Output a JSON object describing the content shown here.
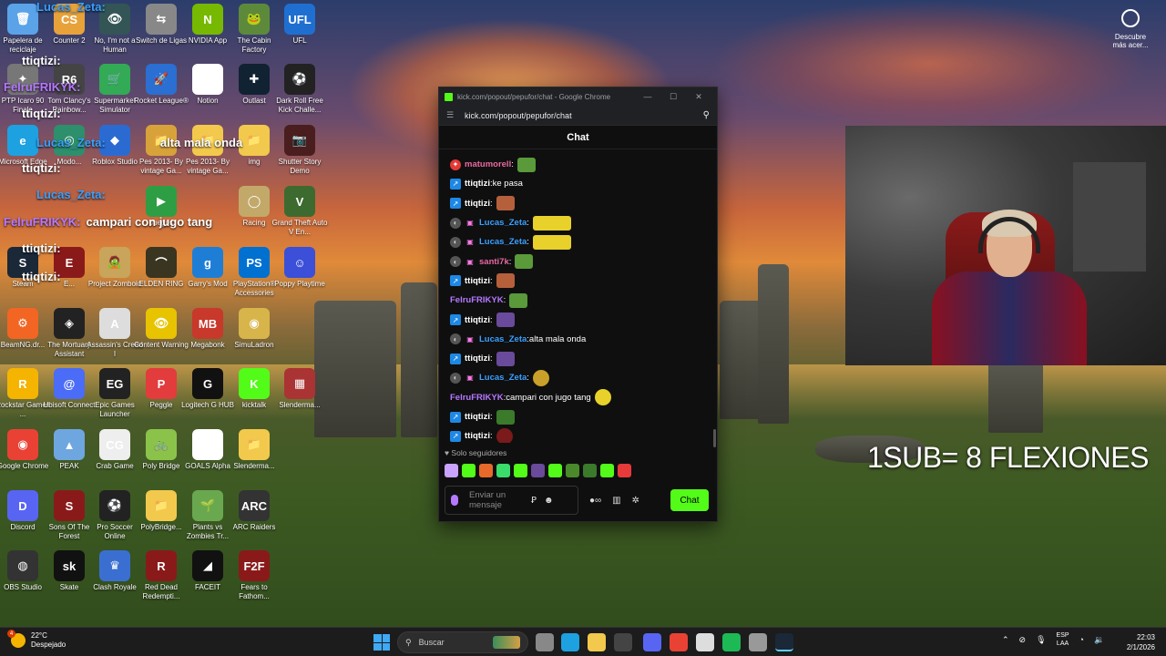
{
  "desktop_icons": [
    {
      "label": "Papelera de reciclaje",
      "color": "#5aa3e8",
      "glyph": "🗑"
    },
    {
      "label": "Counter 2",
      "color": "#e8a23a",
      "glyph": "CS"
    },
    {
      "label": "No, I'm not a Human",
      "color": "#355",
      "glyph": "👁"
    },
    {
      "label": "Switch de Ligas",
      "color": "#888",
      "glyph": "⇆"
    },
    {
      "label": "NVIDIA App",
      "color": "#76b900",
      "glyph": "N"
    },
    {
      "label": "The Cabin Factory",
      "color": "#5d8a3a",
      "glyph": "🐸"
    },
    {
      "label": "UFL",
      "color": "#1f6fd1",
      "glyph": "UFL"
    },
    {
      "label": "PTP Icaro 90 Finale",
      "color": "#777",
      "glyph": "✦"
    },
    {
      "label": "Tom Clancy's Rainbow...",
      "color": "#444",
      "glyph": "R6"
    },
    {
      "label": "Supermarket Simulator",
      "color": "#3a5",
      "glyph": "🛒"
    },
    {
      "label": "Rocket League®",
      "color": "#2a6fd1",
      "glyph": "🚀"
    },
    {
      "label": "Notion",
      "color": "#fff",
      "glyph": "N"
    },
    {
      "label": "Outlast",
      "color": "#123",
      "glyph": "✚"
    },
    {
      "label": "Dark Roll Free Kick Challe...",
      "color": "#222",
      "glyph": "⚽"
    },
    {
      "label": "Microsoft Edge",
      "color": "#1da1e0",
      "glyph": "e"
    },
    {
      "label": "Modo...",
      "color": "#2d8f6b",
      "glyph": "◎"
    },
    {
      "label": "Roblox Studio",
      "color": "#2b6bd1",
      "glyph": "◆"
    },
    {
      "label": "Pes 2013- By vintage Ga...",
      "color": "#d8a23a",
      "glyph": "📁"
    },
    {
      "label": "Pes 2013- By vintage Ga...",
      "color": "#f2c94c",
      "glyph": "📁"
    },
    {
      "label": "img",
      "color": "#f2c94c",
      "glyph": "📁"
    },
    {
      "label": "Shutter Story Demo",
      "color": "#4a1e1e",
      "glyph": "📷"
    },
    {
      "label": "Juegos",
      "color": "#2e9e44",
      "glyph": "▶"
    },
    {
      "label": "Racing",
      "color": "#c2a96a",
      "glyph": "◯"
    },
    {
      "label": "Grand Theft Auto V En...",
      "color": "#3d6b2f",
      "glyph": "V"
    },
    {
      "label": "Steam",
      "color": "#1b2838",
      "glyph": "S"
    },
    {
      "label": "E...",
      "color": "#8a1a1a",
      "glyph": "E"
    },
    {
      "label": "Project Zomboid",
      "color": "#c9a45b",
      "glyph": "🧟"
    },
    {
      "label": "ELDEN RING",
      "color": "#3a3520",
      "glyph": "⌒"
    },
    {
      "label": "Garry's Mod",
      "color": "#1e7ed6",
      "glyph": "g"
    },
    {
      "label": "PlayStation® Accessories",
      "color": "#0070d1",
      "glyph": "PS"
    },
    {
      "label": "Poppy Playtime",
      "color": "#3b4fd8",
      "glyph": "☺"
    },
    {
      "label": "BeamNG.dr...",
      "color": "#f26522",
      "glyph": "⚙"
    },
    {
      "label": "The Mortuary Assistant",
      "color": "#222",
      "glyph": "◈"
    },
    {
      "label": "Assassin's Creed I",
      "color": "#ddd",
      "glyph": "A"
    },
    {
      "label": "Content Warning",
      "color": "#e8c300",
      "glyph": "👁"
    },
    {
      "label": "Megabonk",
      "color": "#c8382b",
      "glyph": "MB"
    },
    {
      "label": "SimuLadron",
      "color": "#d7b54a",
      "glyph": "◉"
    },
    {
      "label": "Rockstar Games ...",
      "color": "#f4b400",
      "glyph": "R"
    },
    {
      "label": "Ubisoft Connect",
      "color": "#4a6cf7",
      "glyph": "@"
    },
    {
      "label": "Epic Games Launcher",
      "color": "#222",
      "glyph": "EG"
    },
    {
      "label": "Peggle",
      "color": "#e23c3c",
      "glyph": "P"
    },
    {
      "label": "Logitech G HUB",
      "color": "#111",
      "glyph": "G"
    },
    {
      "label": "kicktalk",
      "color": "#53fc18",
      "glyph": "K"
    },
    {
      "label": "Slenderma...",
      "color": "#a33",
      "glyph": "▦"
    },
    {
      "label": "Google Chrome",
      "color": "#e94235",
      "glyph": "◉"
    },
    {
      "label": "PEAK",
      "color": "#6ea6e0",
      "glyph": "▲"
    },
    {
      "label": "Crab Game",
      "color": "#eee",
      "glyph": "CG"
    },
    {
      "label": "Poly Bridge",
      "color": "#8bc34a",
      "glyph": "🚲"
    },
    {
      "label": "GOALS Alpha",
      "color": "#fff",
      "glyph": "G"
    },
    {
      "label": "Slenderma...",
      "color": "#f2c94c",
      "glyph": "📁"
    },
    {
      "label": "Discord",
      "color": "#5865f2",
      "glyph": "D"
    },
    {
      "label": "Sons Of The Forest",
      "color": "#8a1a1a",
      "glyph": "S"
    },
    {
      "label": "Pro Soccer Online",
      "color": "#222",
      "glyph": "⚽"
    },
    {
      "label": "PolyBridge...",
      "color": "#f2c94c",
      "glyph": "📁"
    },
    {
      "label": "Plants vs Zombies Tr...",
      "color": "#6aa84f",
      "glyph": "🌱"
    },
    {
      "label": "ARC Raiders",
      "color": "#333",
      "glyph": "ARC"
    },
    {
      "label": "OBS Studio",
      "color": "#333",
      "glyph": "◍"
    },
    {
      "label": "Skate",
      "color": "#111",
      "glyph": "sk"
    },
    {
      "label": "Clash Royale",
      "color": "#3a6fd1",
      "glyph": "♛"
    },
    {
      "label": "Red Dead Redempti...",
      "color": "#8a1a1a",
      "glyph": "R"
    },
    {
      "label": "FACEIT",
      "color": "#111",
      "glyph": "◢"
    },
    {
      "label": "Fears to Fathom...",
      "color": "#8a1a1a",
      "glyph": "F2F"
    }
  ],
  "overlay_lines": [
    {
      "user": "Lucas_Zeta:",
      "text": "",
      "color": "blue"
    },
    {
      "user": "ttiqtizi:",
      "text": "",
      "color": "white"
    },
    {
      "user": "FelruFRIKYK:",
      "text": "",
      "color": "purple"
    },
    {
      "user": "ttiqtizi:",
      "text": "",
      "color": "white"
    },
    {
      "user": "Lucas_Zeta:",
      "text": "alta mala onda",
      "color": "blue"
    },
    {
      "user": "ttiqtizi:",
      "text": "",
      "color": "white"
    },
    {
      "user": "Lucas_Zeta:",
      "text": "",
      "color": "blue"
    },
    {
      "user": "FelruFRIKYK:",
      "text": "campari con jugo tang",
      "color": "purple"
    },
    {
      "user": "ttiqtizi:",
      "text": "",
      "color": "white"
    },
    {
      "user": "ttiqtizi:",
      "text": "",
      "color": "white"
    }
  ],
  "widget": {
    "label": "Descubre más acer..."
  },
  "browser": {
    "title": "kick.com/popout/pepufor/chat - Google Chrome",
    "url": "kick.com/popout/pepufor/chat",
    "chat_header": "Chat",
    "messages": [
      {
        "user": "matumorell",
        "text": "",
        "user_color": "#e86aa0",
        "badge": "fire",
        "emote": "#5a9a3a"
      },
      {
        "user": "ttiqtizi",
        "text": "ke pasa",
        "user_color": "#ffffff",
        "badge": "verified",
        "emote": ""
      },
      {
        "user": "ttiqtizi",
        "text": "",
        "user_color": "#ffffff",
        "badge": "verified",
        "emote": "#b5603a"
      },
      {
        "user": "Lucas_Zeta",
        "text": "",
        "user_color": "#3aa0ff",
        "badge": "mod",
        "emote": "#e8d12a",
        "wide": true
      },
      {
        "user": "Lucas_Zeta",
        "text": "",
        "user_color": "#3aa0ff",
        "badge": "mod",
        "emote": "#e8d12a",
        "wide": true
      },
      {
        "user": "santi7k",
        "text": "",
        "user_color": "#e86aa0",
        "badge": "mod",
        "emote": "#5a9a3a"
      },
      {
        "user": "ttiqtizi",
        "text": "",
        "user_color": "#ffffff",
        "badge": "verified",
        "emote": "#b5603a"
      },
      {
        "user": "FelruFRIKYK",
        "text": "",
        "user_color": "#b678ff",
        "badge": "",
        "emote": "#5a9a3a"
      },
      {
        "user": "ttiqtizi",
        "text": "",
        "user_color": "#ffffff",
        "badge": "verified",
        "emote": "#6a4a9a"
      },
      {
        "user": "Lucas_Zeta",
        "text": "alta mala onda",
        "user_color": "#3aa0ff",
        "badge": "mod",
        "emote": ""
      },
      {
        "user": "ttiqtizi",
        "text": "",
        "user_color": "#ffffff",
        "badge": "verified",
        "emote": "#6a4a9a"
      },
      {
        "user": "Lucas_Zeta",
        "text": "",
        "user_color": "#3aa0ff",
        "badge": "mod",
        "emote": "#c9a02a",
        "round": true
      },
      {
        "user": "FelruFRIKYK",
        "text": "campari con jugo tang",
        "user_color": "#b678ff",
        "badge": "",
        "emote": "#e8d12a",
        "round": true
      },
      {
        "user": "ttiqtizi",
        "text": "",
        "user_color": "#ffffff",
        "badge": "verified",
        "emote": "#3a7a2a"
      },
      {
        "user": "ttiqtizi",
        "text": "",
        "user_color": "#ffffff",
        "badge": "verified",
        "emote": "#7a1a1a",
        "round": true
      }
    ],
    "followers_label": "Solo seguidores",
    "emote_colors": [
      "#c9a3ff",
      "#53fc18",
      "#e86a2a",
      "#3adc6a",
      "#53fc18",
      "#6a4a9a",
      "#53fc18",
      "#4a8a2a",
      "#3a7a2a",
      "#53fc18",
      "#e83a3a"
    ],
    "input_placeholder": "Enviar un mensaje",
    "send_label": "Chat"
  },
  "big_text": "1SUB= 8 FLEXIONES",
  "taskbar": {
    "weather_temp": "22°C",
    "weather_desc": "Despejado",
    "weather_alert": "4",
    "search_placeholder": "Buscar",
    "lang_top": "ESP",
    "lang_bottom": "LAA",
    "time": "22:03",
    "date": "2/1/2026",
    "apps": [
      {
        "name": "task-view",
        "color": "#888"
      },
      {
        "name": "edge",
        "color": "#1da1e0"
      },
      {
        "name": "explorer",
        "color": "#f2c94c"
      },
      {
        "name": "store",
        "color": "#444"
      },
      {
        "name": "discord",
        "color": "#5865f2"
      },
      {
        "name": "chrome",
        "color": "#e94235"
      },
      {
        "name": "github",
        "color": "#ddd"
      },
      {
        "name": "spotify",
        "color": "#1db954"
      },
      {
        "name": "settings",
        "color": "#999"
      },
      {
        "name": "steam",
        "color": "#1b2838"
      }
    ]
  }
}
